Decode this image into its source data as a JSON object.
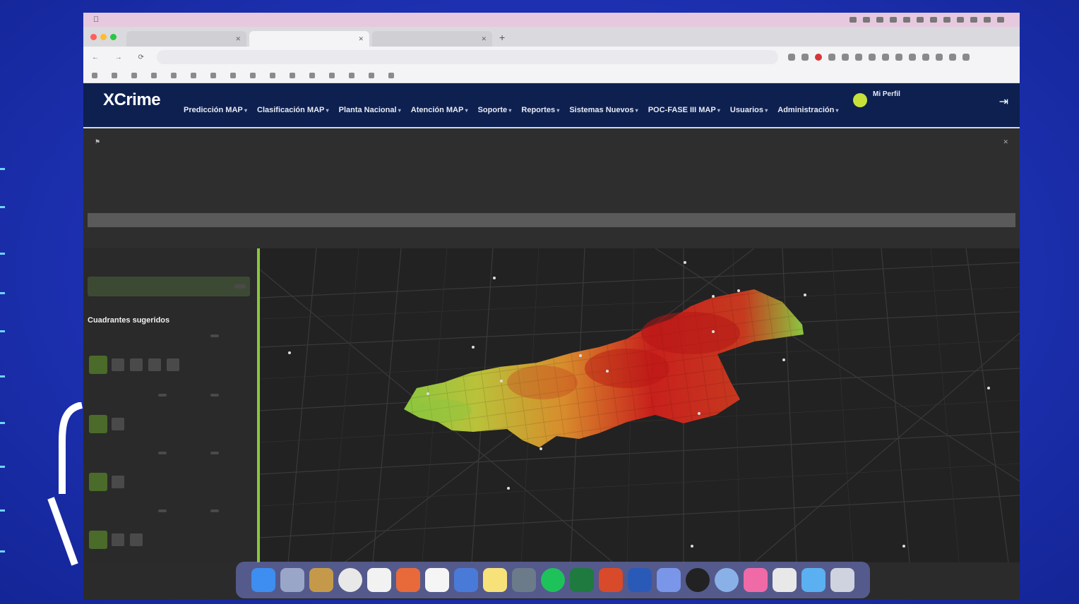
{
  "browser": {
    "menubar": {
      "apple": "",
      "items": [
        "",
        "",
        "",
        "",
        "",
        "",
        "",
        "",
        "",
        ""
      ],
      "clock": ""
    },
    "tabs": [
      {
        "label": ""
      },
      {
        "label": ""
      },
      {
        "label": ""
      }
    ],
    "url": "",
    "bookmarks": [
      "",
      "",
      "",
      "",
      "",
      "",
      "",
      "",
      "",
      "",
      "",
      "",
      "",
      "",
      "",
      ""
    ]
  },
  "app": {
    "brand": "XCrime",
    "brand_tagline": "",
    "nav": [
      "Predicción MAP",
      "Clasificación MAP",
      "Planta Nacional",
      "Atención MAP",
      "Soporte",
      "Reportes",
      "Sistemas Nuevos",
      "POC-FASE III MAP",
      "Usuarios",
      "Administración"
    ],
    "user_name": "",
    "user_role": "",
    "user_profile": "Mi Perfil",
    "logout_icon": "logout-icon"
  },
  "dropdown": {
    "header": "",
    "items": [
      "",
      "",
      "",
      "",
      "",
      ""
    ],
    "highlighted_index": 4
  },
  "panel": {
    "row_label": "",
    "row_value": "",
    "select_label": "",
    "select_value": "",
    "section_title": "Cuadrantes sugeridos",
    "cards": [
      {
        "title": "",
        "tags": [
          ""
        ],
        "buttons": [
          "",
          "",
          "",
          ""
        ],
        "meta": [
          "",
          ""
        ]
      },
      {
        "title": "",
        "tags": [
          "",
          ""
        ],
        "buttons": [
          ""
        ],
        "meta": [
          "",
          ""
        ]
      },
      {
        "title": "",
        "tags": [
          "",
          ""
        ],
        "buttons": [
          ""
        ],
        "meta": [
          "",
          ""
        ]
      },
      {
        "title": "",
        "tags": [
          "",
          ""
        ],
        "buttons": [
          "",
          ""
        ],
        "meta": [
          "",
          ""
        ]
      }
    ]
  },
  "map": {
    "heat_colors": {
      "low": "#8bc63f",
      "mid": "#e0a030",
      "high": "#c8201c"
    },
    "labels": [
      "",
      "",
      "",
      "",
      "",
      "",
      "",
      "",
      "",
      "",
      "",
      "",
      "",
      "",
      "",
      "",
      "",
      "",
      ""
    ]
  },
  "colors": {
    "header_bg": "#0d2050",
    "accent_green": "#8bc63f"
  }
}
